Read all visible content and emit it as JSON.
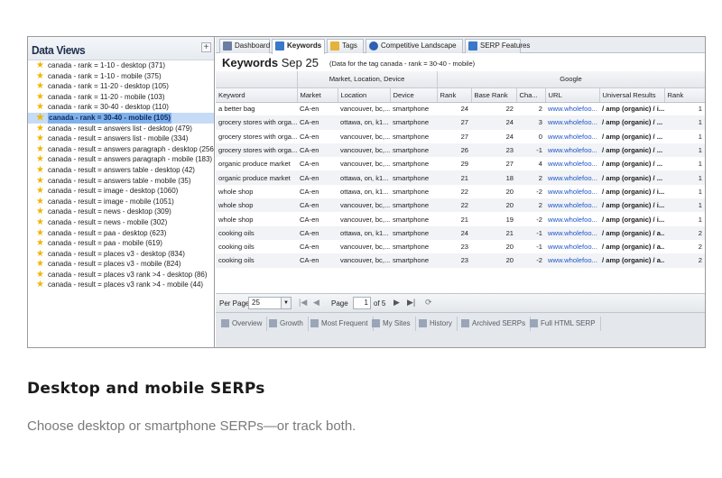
{
  "left_panel": {
    "title": "Data Views",
    "add_symbol": "+",
    "items": [
      {
        "label": "canada - rank = 1-10 - desktop (371)",
        "selected": false
      },
      {
        "label": "canada - rank = 1-10 - mobile (375)",
        "selected": false
      },
      {
        "label": "canada - rank = 11-20 - desktop (105)",
        "selected": false
      },
      {
        "label": "canada - rank = 11-20 - mobile (103)",
        "selected": false
      },
      {
        "label": "canada - rank = 30-40 - desktop (110)",
        "selected": false
      },
      {
        "label": "canada - rank = 30-40 - mobile (105)",
        "selected": true
      },
      {
        "label": "canada - result = answers list - desktop (479)",
        "selected": false
      },
      {
        "label": "canada - result = answers list - mobile (334)",
        "selected": false
      },
      {
        "label": "canada - result = answers paragraph - desktop (256)",
        "selected": false
      },
      {
        "label": "canada - result = answers paragraph - mobile (183)",
        "selected": false
      },
      {
        "label": "canada - result = answers table - desktop (42)",
        "selected": false
      },
      {
        "label": "canada - result = answers table - mobile (35)",
        "selected": false
      },
      {
        "label": "canada - result = image - desktop (1060)",
        "selected": false
      },
      {
        "label": "canada - result = image - mobile (1051)",
        "selected": false
      },
      {
        "label": "canada - result = news - desktop (309)",
        "selected": false
      },
      {
        "label": "canada - result = news - mobile (302)",
        "selected": false
      },
      {
        "label": "canada - result = paa - desktop (623)",
        "selected": false
      },
      {
        "label": "canada - result = paa - mobile (619)",
        "selected": false
      },
      {
        "label": "canada - result = places v3 - desktop (834)",
        "selected": false
      },
      {
        "label": "canada - result = places v3 - mobile (824)",
        "selected": false
      },
      {
        "label": "canada - result = places v3 rank >4 - desktop (86)",
        "selected": false
      },
      {
        "label": "canada - result = places v3 rank >4 - mobile (44)",
        "selected": false
      }
    ]
  },
  "tabs": [
    {
      "label": "Dashboard",
      "icon": "dashboard-icon",
      "active": false
    },
    {
      "label": "Keywords",
      "icon": "keywords-icon",
      "active": true
    },
    {
      "label": "Tags",
      "icon": "tag-icon",
      "active": false
    },
    {
      "label": "Competitive Landscape",
      "icon": "person-icon",
      "active": false
    },
    {
      "label": "SERP Features",
      "icon": "bar-chart-icon",
      "active": false
    }
  ],
  "header": {
    "title": "Keywords",
    "date": "Sep 25",
    "note": "(Data for the tag canada - rank = 30-40 - mobile)"
  },
  "table": {
    "group_headers": [
      "",
      "Market, Location, Device",
      "Google"
    ],
    "columns": [
      "Keyword",
      "Market",
      "Location",
      "Device",
      "Rank",
      "Base Rank",
      "Cha...",
      "URL",
      "Universal Results",
      "Rank"
    ],
    "rows": [
      [
        "a better bag",
        "CA-en",
        "vancouver, bc,...",
        "smartphone",
        "24",
        "22",
        "2",
        "www.wholefoo...",
        "/ amp (organic) / i...",
        "1"
      ],
      [
        "grocery stores with orga...",
        "CA-en",
        "ottawa, on, k1...",
        "smartphone",
        "27",
        "24",
        "3",
        "www.wholefoo...",
        "/ amp (organic) / ...",
        "1"
      ],
      [
        "grocery stores with orga...",
        "CA-en",
        "vancouver, bc,...",
        "smartphone",
        "27",
        "24",
        "0",
        "www.wholefoo...",
        "/ amp (organic) / ...",
        "1"
      ],
      [
        "grocery stores with orga...",
        "CA-en",
        "vancouver, bc,...",
        "smartphone",
        "26",
        "23",
        "-1",
        "www.wholefoo...",
        "/ amp (organic) / ...",
        "1"
      ],
      [
        "organic produce market",
        "CA-en",
        "vancouver, bc,...",
        "smartphone",
        "29",
        "27",
        "4",
        "www.wholefoo...",
        "/ amp (organic) / ...",
        "1"
      ],
      [
        "organic produce market",
        "CA-en",
        "ottawa, on, k1...",
        "smartphone",
        "21",
        "18",
        "2",
        "www.wholefoo...",
        "/ amp (organic) / ...",
        "1"
      ],
      [
        "whole shop",
        "CA-en",
        "ottawa, on, k1...",
        "smartphone",
        "22",
        "20",
        "-2",
        "www.wholefoo...",
        "/ amp (organic) / i...",
        "1"
      ],
      [
        "whole shop",
        "CA-en",
        "vancouver, bc,...",
        "smartphone",
        "22",
        "20",
        "2",
        "www.wholefoo...",
        "/ amp (organic) / i...",
        "1"
      ],
      [
        "whole shop",
        "CA-en",
        "vancouver, bc,...",
        "smartphone",
        "21",
        "19",
        "-2",
        "www.wholefoo...",
        "/ amp (organic) / i...",
        "1"
      ],
      [
        "cooking oils",
        "CA-en",
        "ottawa, on, k1...",
        "smartphone",
        "24",
        "21",
        "-1",
        "www.wholefoo...",
        "/ amp (organic) / a...",
        "2"
      ],
      [
        "cooking oils",
        "CA-en",
        "vancouver, bc,...",
        "smartphone",
        "23",
        "20",
        "-1",
        "www.wholefoo...",
        "/ amp (organic) / a...",
        "2"
      ],
      [
        "cooking oils",
        "CA-en",
        "vancouver, bc,...",
        "smartphone",
        "23",
        "20",
        "-2",
        "www.wholefoo...",
        "/ amp (organic) / a...",
        "2"
      ]
    ]
  },
  "pager": {
    "per_page_label": "Per Page:",
    "per_page_value": "25",
    "page_label": "Page",
    "page_value": "1",
    "of_label": "of 5"
  },
  "bottom_tabs": [
    {
      "label": "Overview",
      "icon": "bar-chart-icon"
    },
    {
      "label": "Growth",
      "icon": "line-chart-icon"
    },
    {
      "label": "Most Frequent",
      "icon": "bar-chart-icon"
    },
    {
      "label": "My Sites",
      "icon": "bar-chart-icon"
    },
    {
      "label": "History",
      "icon": "history-icon"
    },
    {
      "label": "Archived SERPs",
      "icon": "archive-icon"
    },
    {
      "label": "Full HTML SERP",
      "icon": "document-icon"
    }
  ],
  "caption": {
    "title": "Desktop and mobile SERPs",
    "subtitle": "Choose desktop or smartphone SERPs—or track both."
  }
}
